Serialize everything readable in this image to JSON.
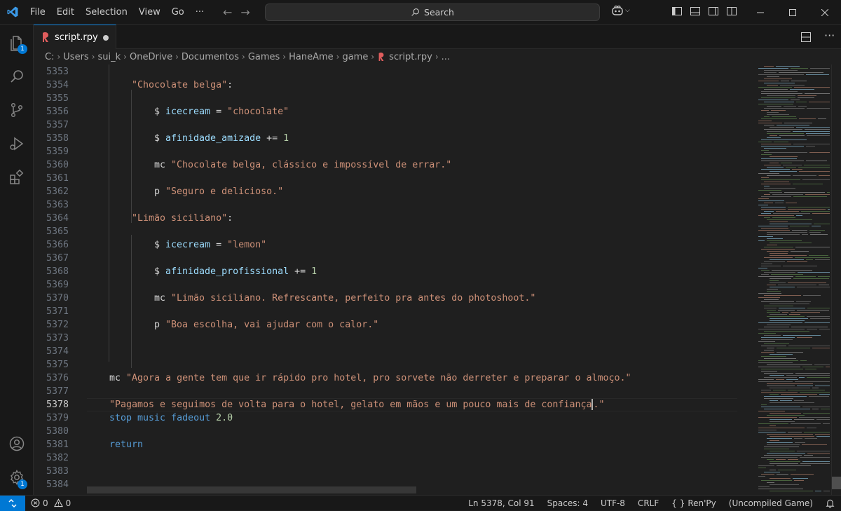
{
  "titlebar": {
    "menu": [
      "File",
      "Edit",
      "Selection",
      "View",
      "Go",
      "···"
    ],
    "search_placeholder": "Search",
    "window_controls": [
      "minimize",
      "maximize",
      "close"
    ]
  },
  "activity_bar": {
    "explorer_badge": "1",
    "settings_badge": "1"
  },
  "tab": {
    "filename": "script.rpy",
    "modified": true
  },
  "breadcrumb": [
    "C:",
    "Users",
    "sui_k",
    "OneDrive",
    "Documentos",
    "Games",
    "HaneAme",
    "game",
    "script.rpy",
    "..."
  ],
  "editor": {
    "active_line": 5378,
    "lines": [
      {
        "n": "5353",
        "indent": 0,
        "tokens": []
      },
      {
        "n": "5354",
        "indent": 8,
        "tokens": [
          {
            "t": "\"Chocolate belga\"",
            "c": "str"
          },
          {
            "t": ":",
            "c": "plain"
          }
        ]
      },
      {
        "n": "5355",
        "indent": 0,
        "tokens": []
      },
      {
        "n": "5356",
        "indent": 12,
        "tokens": [
          {
            "t": "$ ",
            "c": "plain"
          },
          {
            "t": "icecream",
            "c": "var"
          },
          {
            "t": " = ",
            "c": "op"
          },
          {
            "t": "\"chocolate\"",
            "c": "str"
          }
        ]
      },
      {
        "n": "5357",
        "indent": 0,
        "tokens": []
      },
      {
        "n": "5358",
        "indent": 12,
        "tokens": [
          {
            "t": "$ ",
            "c": "plain"
          },
          {
            "t": "afinidade_amizade",
            "c": "var"
          },
          {
            "t": " += ",
            "c": "op"
          },
          {
            "t": "1",
            "c": "num"
          }
        ]
      },
      {
        "n": "5359",
        "indent": 0,
        "tokens": []
      },
      {
        "n": "5360",
        "indent": 12,
        "tokens": [
          {
            "t": "mc ",
            "c": "plain"
          },
          {
            "t": "\"Chocolate belga, clássico e impossível de errar.\"",
            "c": "str"
          }
        ]
      },
      {
        "n": "5361",
        "indent": 0,
        "tokens": []
      },
      {
        "n": "5362",
        "indent": 12,
        "tokens": [
          {
            "t": "p ",
            "c": "plain"
          },
          {
            "t": "\"Seguro e delicioso.\"",
            "c": "str"
          }
        ]
      },
      {
        "n": "5363",
        "indent": 0,
        "tokens": []
      },
      {
        "n": "5364",
        "indent": 8,
        "tokens": [
          {
            "t": "\"Limão siciliano\"",
            "c": "str"
          },
          {
            "t": ":",
            "c": "plain"
          }
        ]
      },
      {
        "n": "5365",
        "indent": 0,
        "tokens": []
      },
      {
        "n": "5366",
        "indent": 12,
        "tokens": [
          {
            "t": "$ ",
            "c": "plain"
          },
          {
            "t": "icecream",
            "c": "var"
          },
          {
            "t": " = ",
            "c": "op"
          },
          {
            "t": "\"lemon\"",
            "c": "str"
          }
        ]
      },
      {
        "n": "5367",
        "indent": 0,
        "tokens": []
      },
      {
        "n": "5368",
        "indent": 12,
        "tokens": [
          {
            "t": "$ ",
            "c": "plain"
          },
          {
            "t": "afinidade_profissional",
            "c": "var"
          },
          {
            "t": " += ",
            "c": "op"
          },
          {
            "t": "1",
            "c": "num"
          }
        ]
      },
      {
        "n": "5369",
        "indent": 0,
        "tokens": []
      },
      {
        "n": "5370",
        "indent": 12,
        "tokens": [
          {
            "t": "mc ",
            "c": "plain"
          },
          {
            "t": "\"Limão siciliano. Refrescante, perfeito pra antes do photoshoot.\"",
            "c": "str"
          }
        ]
      },
      {
        "n": "5371",
        "indent": 0,
        "tokens": []
      },
      {
        "n": "5372",
        "indent": 12,
        "tokens": [
          {
            "t": "p ",
            "c": "plain"
          },
          {
            "t": "\"Boa escolha, vai ajudar com o calor.\"",
            "c": "str"
          }
        ]
      },
      {
        "n": "5373",
        "indent": 0,
        "tokens": []
      },
      {
        "n": "5374",
        "indent": 0,
        "tokens": []
      },
      {
        "n": "5375",
        "indent": 0,
        "tokens": []
      },
      {
        "n": "5376",
        "indent": 4,
        "tokens": [
          {
            "t": "mc ",
            "c": "plain"
          },
          {
            "t": "\"Agora a gente tem que ir rápido pro hotel, pro sorvete não derreter e preparar o almoço.\"",
            "c": "str"
          }
        ]
      },
      {
        "n": "5377",
        "indent": 0,
        "tokens": []
      },
      {
        "n": "5378",
        "indent": 4,
        "tokens": [
          {
            "t": "\"Pagamos e seguimos de volta para o hotel, gelato em mãos e um pouco mais de confiança",
            "c": "str"
          },
          {
            "t": "|",
            "c": "cursor"
          },
          {
            "t": ".\"",
            "c": "str"
          }
        ]
      },
      {
        "n": "5379",
        "indent": 4,
        "tokens": [
          {
            "t": "stop music fadeout",
            "c": "kw"
          },
          {
            "t": " ",
            "c": "plain"
          },
          {
            "t": "2.0",
            "c": "num"
          }
        ]
      },
      {
        "n": "5380",
        "indent": 0,
        "tokens": []
      },
      {
        "n": "5381",
        "indent": 4,
        "tokens": [
          {
            "t": "return",
            "c": "kw"
          }
        ]
      },
      {
        "n": "5382",
        "indent": 0,
        "tokens": []
      },
      {
        "n": "5383",
        "indent": 0,
        "tokens": []
      },
      {
        "n": "5384",
        "indent": 0,
        "tokens": []
      }
    ]
  },
  "statusbar": {
    "errors": "0",
    "warnings": "0",
    "position": "Ln 5378, Col 91",
    "spaces": "Spaces: 4",
    "encoding": "UTF-8",
    "eol": "CRLF",
    "language": "Ren'Py",
    "project": "(Uncompiled Game)"
  },
  "colors": {
    "accent": "#0078d4",
    "string": "#ce9178",
    "variable": "#9cdcfe",
    "number": "#b5cea8",
    "keyword": "#569cd6"
  }
}
